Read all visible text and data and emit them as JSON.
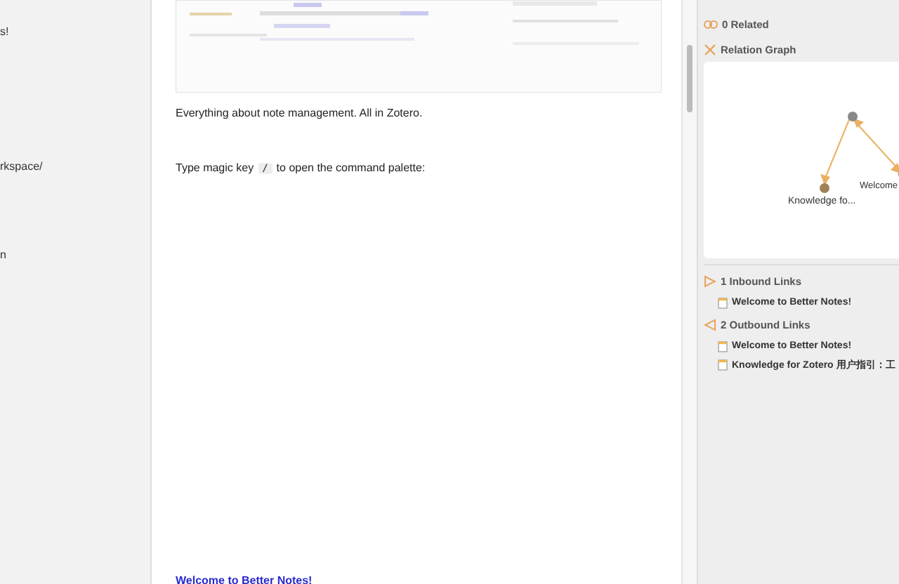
{
  "left_pane": {
    "items": [
      {
        "label": "s!"
      },
      {
        "label": "rkspace/"
      },
      {
        "label": "n"
      }
    ]
  },
  "editor": {
    "paragraphs": [
      {
        "kind": "text",
        "text": "Everything about note management. All in Zotero."
      },
      {
        "kind": "key",
        "before": "Type magic key",
        "key": "/",
        "after": "to open the command palette:"
      }
    ],
    "bottom_link": "Welcome to Better Notes!"
  },
  "right_pane": {
    "related": {
      "title": "0 Related"
    },
    "graph": {
      "title": "Relation Graph",
      "nodes": [
        {
          "label": "Knowledge fo..."
        },
        {
          "label": "Welcome"
        }
      ]
    },
    "inbound": {
      "title": "1 Inbound Links",
      "items": [
        "Welcome to Better Notes!"
      ]
    },
    "outbound": {
      "title": "2 Outbound Links",
      "items": [
        "Welcome to Better Notes!",
        "Knowledge for Zotero 用户指引：工"
      ]
    }
  }
}
